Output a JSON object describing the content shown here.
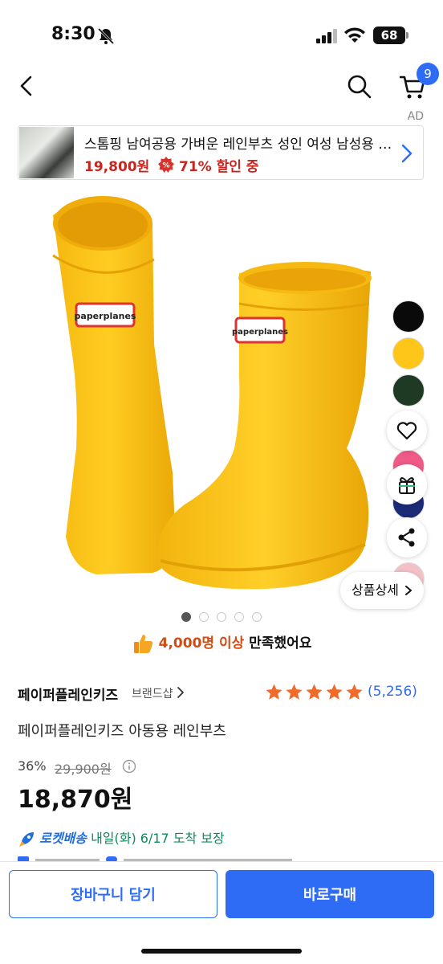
{
  "status_bar": {
    "time": "8:30",
    "battery": "68"
  },
  "nav": {
    "cart_count": "9",
    "ad_label": "AD"
  },
  "ad_banner": {
    "title": "스톰핑 남여공용 가벼운 레인부츠 성인 여성 남성용 장화",
    "price": "19,800원",
    "discount": "71% 할인 중"
  },
  "product_image": {
    "logo_text": "paperplanes"
  },
  "swatches": {
    "colors": [
      "#0a0a0a",
      "#ffc61a",
      "#1e3a24",
      "#ef5a86",
      "#1c2b78",
      "#f3c1c7"
    ]
  },
  "detail_button": {
    "label": "상품상세"
  },
  "carousel": {
    "count": 5,
    "active": 0
  },
  "satisfaction": {
    "count": "4,000명 이상",
    "suffix": " 만족했어요"
  },
  "brand": {
    "name": "페이퍼플레인키즈",
    "shop_label": "브랜드샵"
  },
  "rating": {
    "stars": 5,
    "review_count": "(5,256)"
  },
  "product": {
    "title": "페이퍼플레인키즈 아동용 레인부츠",
    "discount_rate": "36%",
    "original_price": "29,900원",
    "sale_price": "18,870원"
  },
  "delivery": {
    "label": "로켓배송",
    "text": " 내일(화) 6/17 도착 보장"
  },
  "bottom_bar": {
    "add_to_cart": "장바구니 담기",
    "buy_now": "바로구매"
  },
  "colors": {
    "primary": "#2e6cf6",
    "sale_red": "#c8251e",
    "star": "#f06a2a",
    "boot_yellow": "#ffc61a"
  }
}
